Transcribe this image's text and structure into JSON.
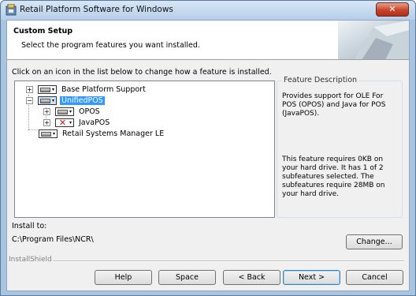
{
  "window": {
    "title": "Retail Platform Software for Windows",
    "close_glyph": "✕"
  },
  "header": {
    "title": "Custom Setup",
    "subtitle": "Select the program features you want installed."
  },
  "instruction": "Click on an icon in the list below to change how a feature is installed.",
  "tree": {
    "items": [
      {
        "label": "Base Platform Support",
        "expander": "+",
        "state": "install"
      },
      {
        "label": "UnifiedPOS",
        "expander": "−",
        "state": "install",
        "selected": true
      },
      {
        "label": "OPOS",
        "expander": "+",
        "state": "install"
      },
      {
        "label": "JavaPOS",
        "expander": "+",
        "state": "not-available"
      },
      {
        "label": "Retail Systems Manager LE",
        "state": "install"
      }
    ],
    "dropdown_arrow": "▾",
    "not_available_glyph": "✕"
  },
  "description": {
    "legend": "Feature Description",
    "text": "Provides support for OLE For POS (OPOS) and Java for POS (JavaPOS).",
    "requirements": "This feature requires 0KB on your hard drive. It has 1 of 2 subfeatures selected. The subfeatures require 28MB on your hard drive."
  },
  "install": {
    "label": "Install to:",
    "path": "C:\\Program Files\\NCR\\"
  },
  "buttons": {
    "change": "Change...",
    "help": "Help",
    "space": "Space",
    "back": "< Back",
    "next": "Next >",
    "cancel": "Cancel"
  },
  "installshield": "InstallShield",
  "colors": {
    "selection": "#3399ff",
    "not_available": "#dd1111",
    "title_bar": "#b6cfe9"
  }
}
